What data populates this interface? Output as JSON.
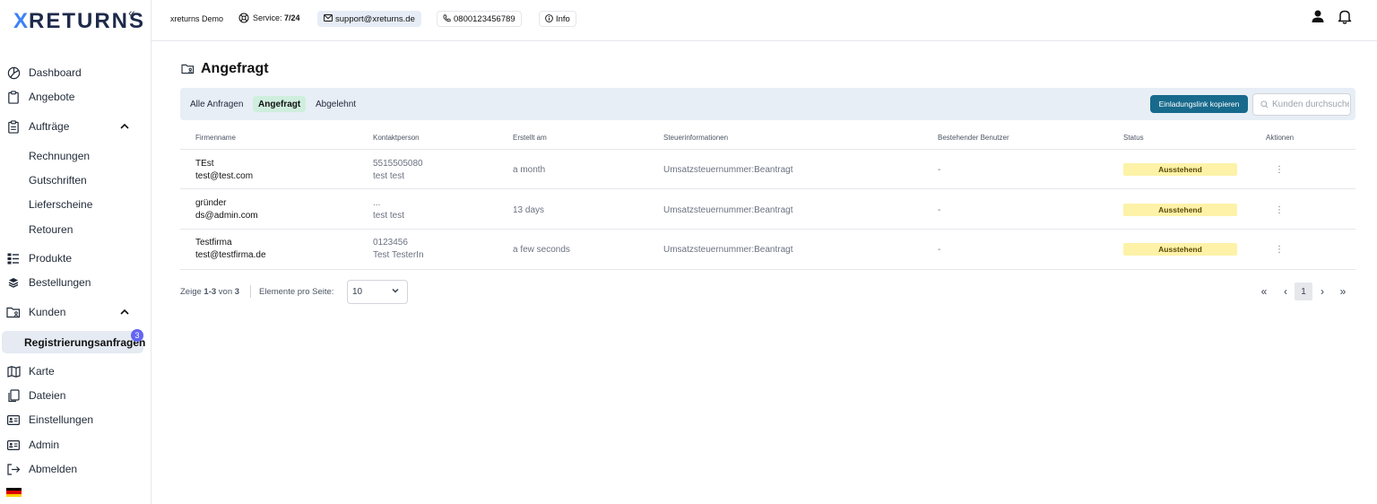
{
  "brand": {
    "logo_x": "X",
    "logo_rest": "RETURNS"
  },
  "sidebar": {
    "collapse_icon": "«",
    "items": [
      {
        "label": "Dashboard",
        "icon": "pie-chart-icon"
      },
      {
        "label": "Angebote",
        "icon": "clipboard-icon"
      },
      {
        "label": "Aufträge",
        "icon": "clipboard-list-icon",
        "expanded": true
      },
      {
        "label": "Rechnungen"
      },
      {
        "label": "Gutschriften"
      },
      {
        "label": "Lieferscheine"
      },
      {
        "label": "Retouren"
      },
      {
        "label": "Produkte",
        "icon": "list-icon"
      },
      {
        "label": "Bestellungen",
        "icon": "layers-icon"
      },
      {
        "label": "Kunden",
        "icon": "folder-user-icon",
        "expanded": true
      },
      {
        "label": "Registrierungsanfragen",
        "badge": "3",
        "active": true
      },
      {
        "label": "Karte",
        "icon": "map-icon"
      },
      {
        "label": "Dateien",
        "icon": "files-icon"
      },
      {
        "label": "Einstellungen",
        "icon": "id-card-icon"
      },
      {
        "label": "Admin",
        "icon": "id-card-icon"
      },
      {
        "label": "Abmelden",
        "icon": "logout-icon"
      }
    ],
    "flag_colors": [
      "#000000",
      "#dd0000",
      "#ffce00"
    ]
  },
  "topbar": {
    "company": "xreturns Demo",
    "service_label": "Service:",
    "service_value": "7/24",
    "email": "support@xreturns.de",
    "phone": "0800123456789",
    "info": "Info"
  },
  "page": {
    "title": "Angefragt",
    "tabs": [
      "Alle Anfragen",
      "Angefragt",
      "Abgelehnt"
    ],
    "active_tab": "Angefragt",
    "invite_button": "Einladungslink kopieren",
    "search_placeholder": "Kunden durchsuchen"
  },
  "table": {
    "columns": [
      "Firmenname",
      "Kontaktperson",
      "Erstellt am",
      "Steuerinformationen",
      "Bestehender Benutzer",
      "Status",
      "Aktionen"
    ],
    "rows": [
      {
        "company": "TEst",
        "email": "test@test.com",
        "contact_line1": "5515505080",
        "contact_line2": "test test",
        "created": "a month",
        "tax": "Umsatzsteuernummer:Beantragt",
        "existing_user": "-",
        "status": "Ausstehend"
      },
      {
        "company": "gründer",
        "email": "ds@admin.com",
        "contact_line1": "...",
        "contact_line2": "test test",
        "created": "13 days",
        "tax": "Umsatzsteuernummer:Beantragt",
        "existing_user": "-",
        "status": "Ausstehend"
      },
      {
        "company": "Testfirma",
        "email": "test@testfirma.de",
        "contact_line1": "0123456",
        "contact_line2": "Test TesterIn",
        "created": "a few seconds",
        "tax": "Umsatzsteuernummer:Beantragt",
        "existing_user": "-",
        "status": "Ausstehend"
      }
    ]
  },
  "footer": {
    "showing_prefix": "Zeige",
    "range": "1-3",
    "of": "von",
    "total": "3",
    "per_page_label": "Elemente pro Seite:",
    "per_page_value": "10",
    "first": "«",
    "prev": "‹",
    "page": "1",
    "next": "›",
    "last": "»"
  }
}
